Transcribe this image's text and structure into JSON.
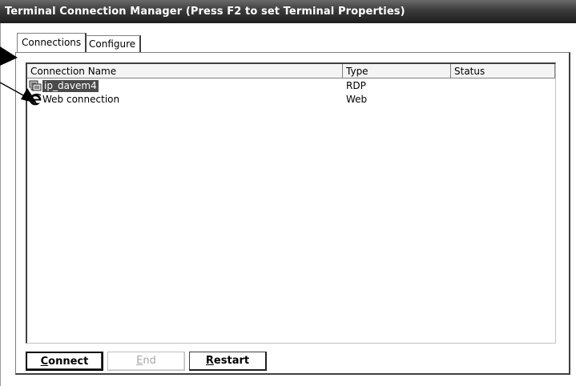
{
  "window": {
    "title": "Terminal Connection Manager (Press F2 to set Terminal Properties)"
  },
  "tabs": [
    {
      "label": "Connections",
      "active": true
    },
    {
      "label": "Configure",
      "active": false
    }
  ],
  "list": {
    "columns": [
      "Connection Name",
      "Type",
      "Status"
    ],
    "rows": [
      {
        "name": "ip_davem4",
        "type": "RDP",
        "status": "",
        "icon": "rdp-connection-icon",
        "selected": true
      },
      {
        "name": "Web connection",
        "type": "Web",
        "status": "",
        "icon": "web-browser-icon",
        "selected": false
      }
    ]
  },
  "buttons": {
    "connect": {
      "first": "C",
      "rest": "onnect",
      "enabled": true
    },
    "end": {
      "first": "E",
      "rest": "nd",
      "enabled": false
    },
    "restart": {
      "first": "R",
      "rest": "estart",
      "enabled": true
    }
  },
  "colors": {
    "titlebar": "#3a3a3a",
    "selection": "#4a4a4a",
    "disabled_text": "#a8a8a8"
  }
}
